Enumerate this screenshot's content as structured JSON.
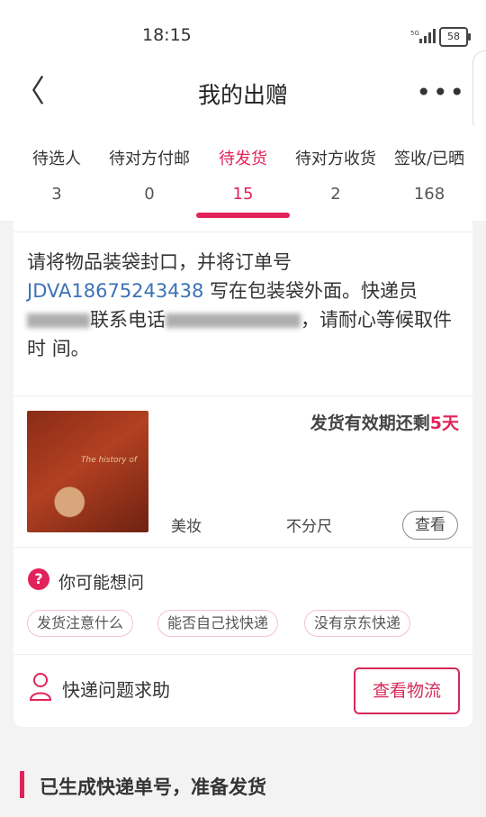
{
  "status": {
    "time": "18:15",
    "battery": "58"
  },
  "nav": {
    "title": "我的出赠",
    "more": "•••"
  },
  "tabs": [
    {
      "label": "待选人",
      "count": "3"
    },
    {
      "label": "待对方付邮",
      "count": "0"
    },
    {
      "label": "待发货",
      "count": "15"
    },
    {
      "label": "待对方收货",
      "count": "2"
    },
    {
      "label": "签收/已晒",
      "count": "168"
    }
  ],
  "instructions": {
    "part1": "请将物品装袋封口，并将订单号 ",
    "order_no": "JDVA18675243438",
    "part2": " 写在包装袋外面。快递员",
    "part3": "联系电话",
    "part4": "，请耐心等候取件时",
    "part5": "间。"
  },
  "item": {
    "deadline_prefix": "发货有效期还剩",
    "deadline_value": "5天",
    "category": "美妆",
    "size": "不分尺",
    "view_label": "查看"
  },
  "faq": {
    "title": "你可能想问",
    "chips": [
      "发货注意什么",
      "能否自己找快递",
      "没有京东快递"
    ]
  },
  "help": {
    "label": "快递问题求助",
    "logistics_button": "查看物流"
  },
  "section": {
    "title": "已生成快递单号，准备发货"
  },
  "colors": {
    "accent": "#e2225a",
    "link": "#3c72b5"
  }
}
